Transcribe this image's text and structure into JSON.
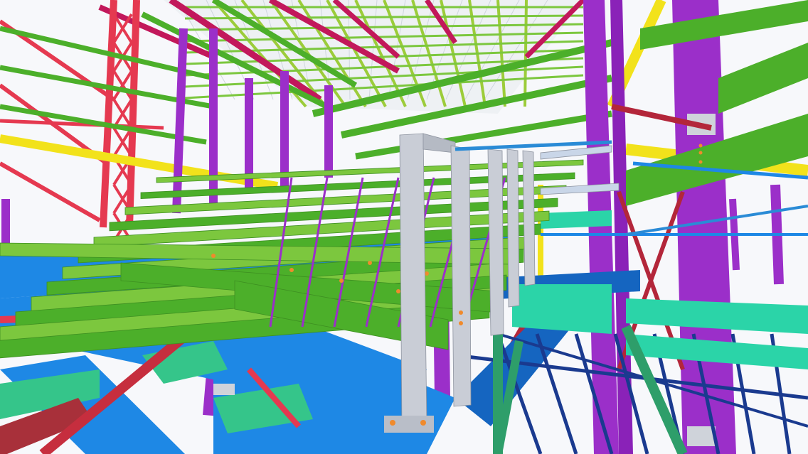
{
  "scene": {
    "palette": {
      "background": "#f7f8fb",
      "roof_panel": "#eef1f4",
      "roof_rafter": "#c2185b",
      "roof_purlin": "#9ccc3a",
      "column_purple": "#9b2fc9",
      "truss_red": "#e53950",
      "green_beam": "#4caf2a",
      "green_beam_light": "#7cc73e",
      "deck_blue": "#1e88e5",
      "deck_blue_dark": "#1565c0",
      "navy_beam": "#1a3a8f",
      "teal_beam": "#2bd4a8",
      "yellow_beam": "#f2e21b",
      "maroon_brace": "#b3263a",
      "grey_column": "#c9cdd6",
      "orange_bolt": "#f08a2c"
    },
    "elements": [
      "roof-panels",
      "roof-rafters",
      "roof-purlins",
      "left-red-truss",
      "purple-columns",
      "stadium-seating-beams",
      "blue-deck-girders",
      "teal-floor-beams",
      "grey-frame-columns",
      "yellow-beams",
      "red-bracing"
    ]
  }
}
